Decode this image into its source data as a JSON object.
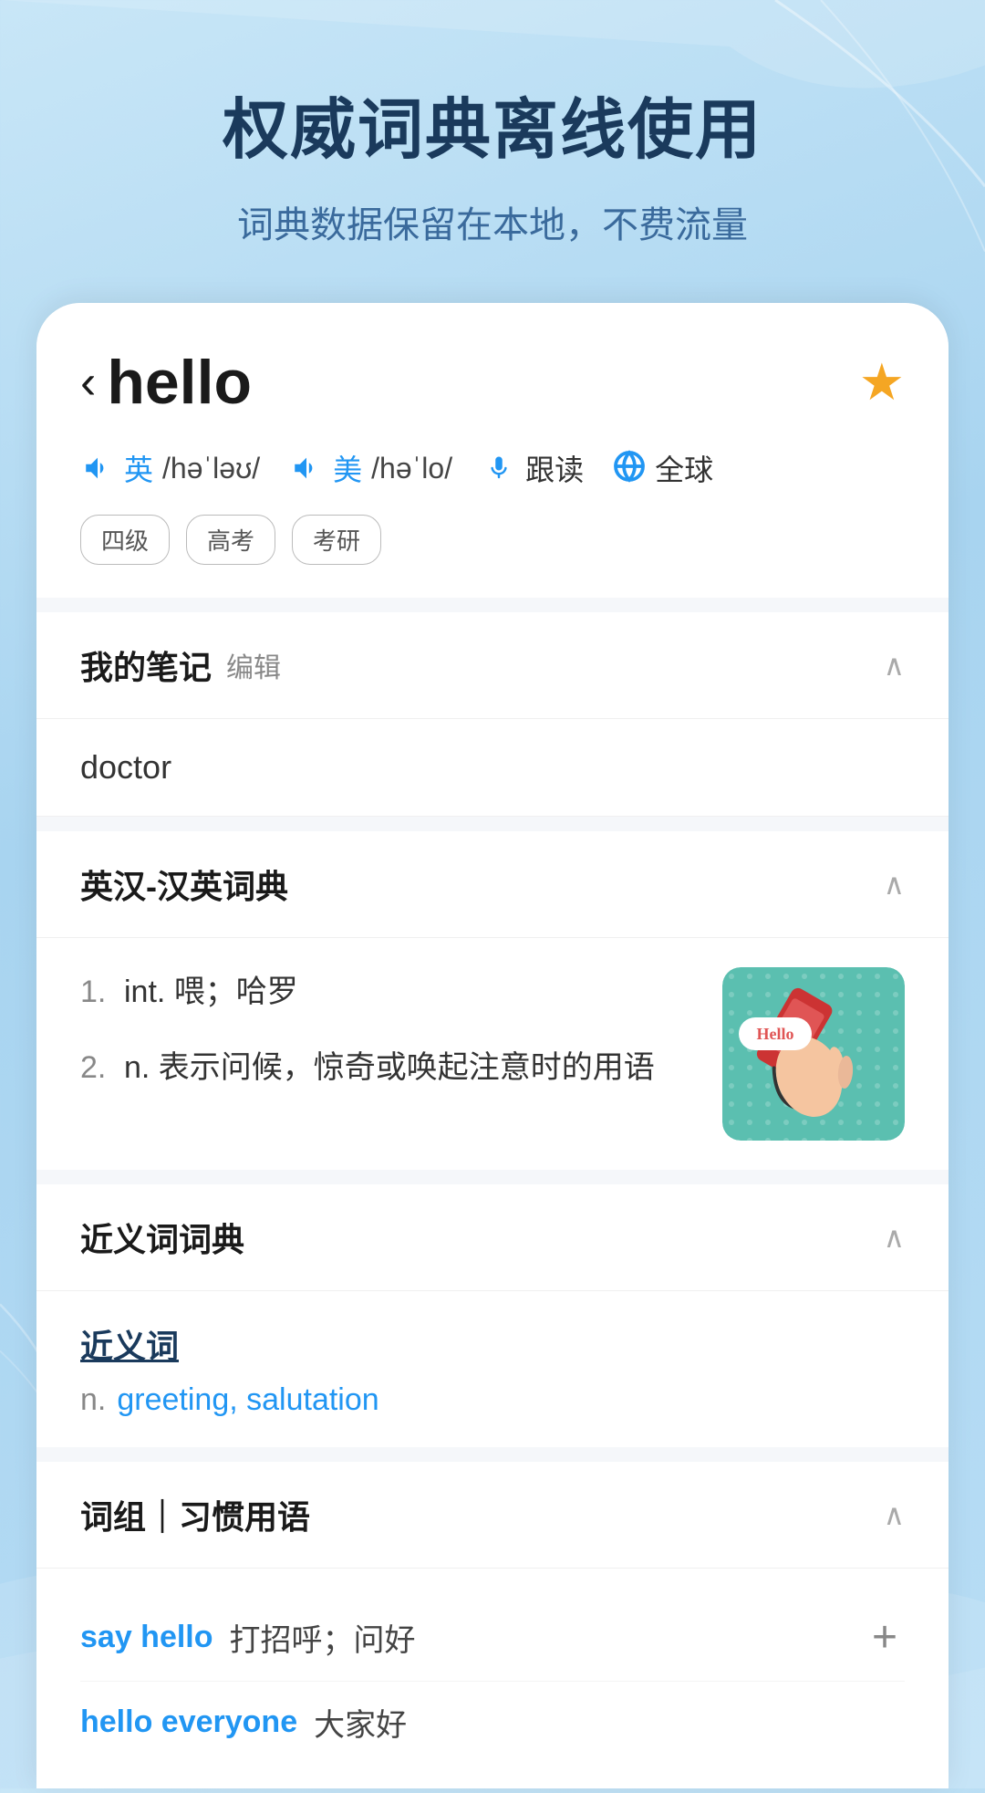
{
  "background": {
    "gradient_from": "#c8e6f7",
    "gradient_to": "#a8d4f0"
  },
  "header": {
    "title": "权威词典离线使用",
    "subtitle": "词典数据保留在本地，不费流量"
  },
  "word": {
    "back_label": "‹",
    "text": "hello",
    "starred": true,
    "pronunciation": {
      "british": {
        "label": "英",
        "phonetic": "/həˈləʊ/"
      },
      "american": {
        "label": "美",
        "phonetic": "/həˈlo/"
      },
      "follow_label": "跟读",
      "global_label": "全球"
    },
    "tags": [
      "四级",
      "高考",
      "考研"
    ]
  },
  "sections": {
    "notes": {
      "title": "我的笔记",
      "edit_label": "编辑",
      "content": "doctor"
    },
    "dictionary": {
      "title": "英汉-汉英词典",
      "definitions": [
        {
          "num": "1.",
          "text": "int. 喂；哈罗"
        },
        {
          "num": "2.",
          "text": "n. 表示问候，惊奇或唤起注意时的用语"
        }
      ]
    },
    "synonyms": {
      "title": "近义词词典",
      "content_title": "近义词",
      "pos": "n.",
      "words": "greeting, salutation"
    },
    "phrases": {
      "title": "词组｜习惯用语",
      "items": [
        {
          "en": "say hello",
          "separator": "　",
          "zh": "打招呼；问好",
          "has_add": true
        },
        {
          "en": "hello everyone",
          "separator": "　",
          "zh": "大家好",
          "has_add": false
        }
      ]
    }
  }
}
